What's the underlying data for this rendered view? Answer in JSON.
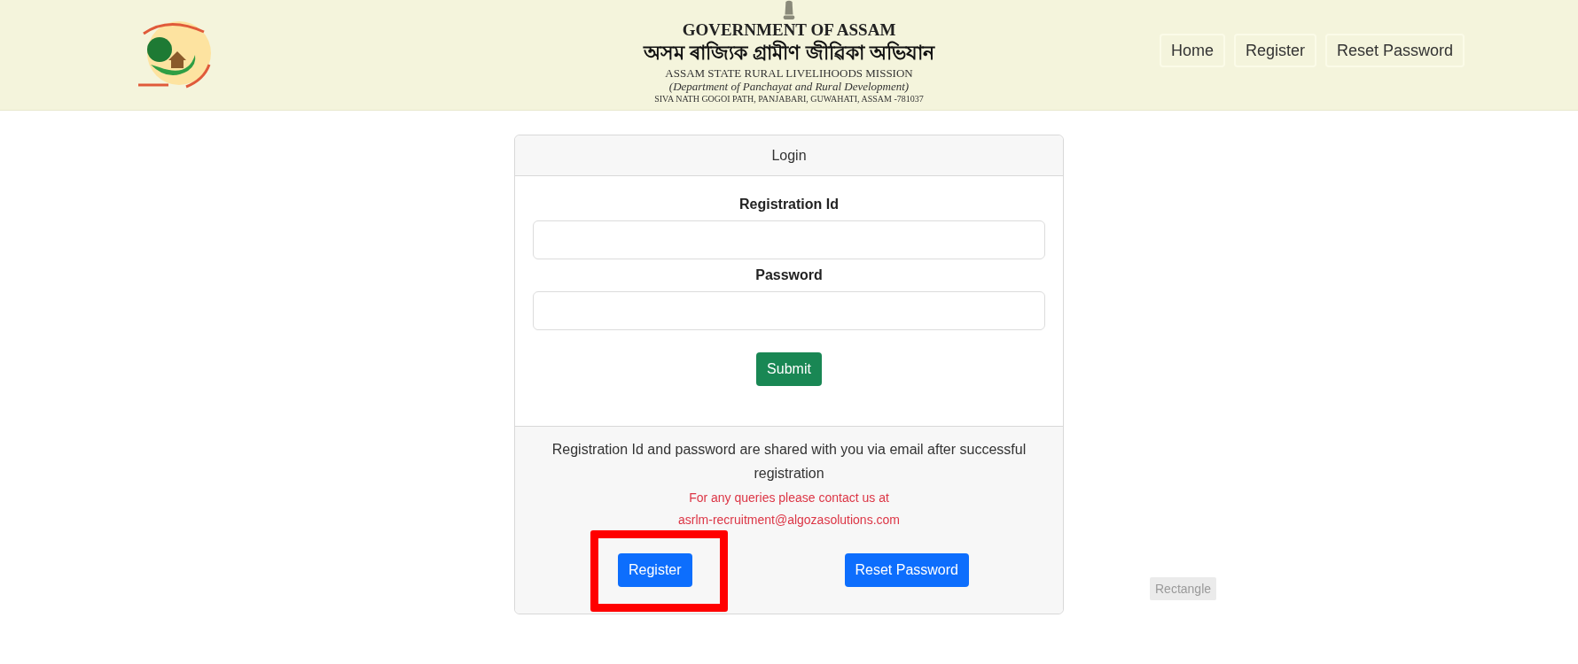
{
  "header": {
    "title": "GOVERNMENT OF ASSAM",
    "title_local": "অসম ৰাজ্যিক গ্ৰামীণ জীৱিকা অভিযান",
    "subtitle": "ASSAM STATE RURAL LIVELIHOODS MISSION",
    "department": "(Department of Panchayat and Rural Development)",
    "address": "SIVA NATH GOGOI PATH, PANJABARI, GUWAHATI, ASSAM -781037"
  },
  "nav": [
    "Home",
    "Register",
    "Reset Password"
  ],
  "login": {
    "title": "Login",
    "fields": [
      {
        "label": "Registration Id"
      },
      {
        "label": "Password"
      }
    ],
    "submit": "Submit",
    "note": "Registration Id and password are shared with you via email after successful registration",
    "contact": "For any queries please contact us at",
    "email": "asrlm-recruitment@algozasolutions.com",
    "buttons": [
      {
        "label": "Register",
        "highlighted": true
      },
      {
        "label": "Reset Password",
        "highlighted": false
      }
    ]
  },
  "tag": "Rectangle"
}
